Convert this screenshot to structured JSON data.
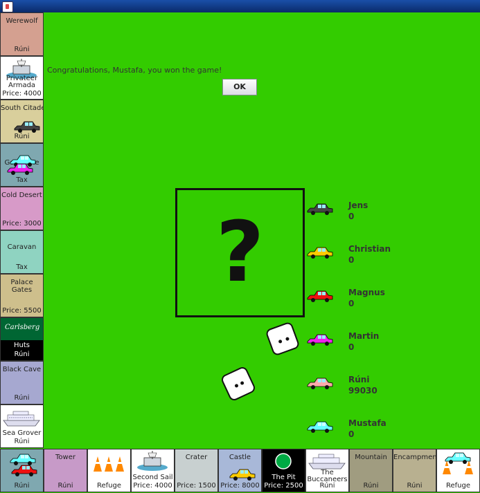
{
  "window": {
    "icon": "java-icon"
  },
  "message": "Congratulations, Mustafa, you won the game!",
  "ok_label": "OK",
  "center": {
    "symbol": "?"
  },
  "players": [
    {
      "name": "Jens",
      "score": "0",
      "color": "#444444"
    },
    {
      "name": "Christian",
      "score": "0",
      "color": "#ffcc00"
    },
    {
      "name": "Magnus",
      "score": "0",
      "color": "#ee1111"
    },
    {
      "name": "Martin",
      "score": "0",
      "color": "#ee22ee"
    },
    {
      "name": "Rúni",
      "score": "99030",
      "color": "#ffaaaa"
    },
    {
      "name": "Mustafa",
      "score": "0",
      "color": "#66ffff"
    }
  ],
  "left_tiles": [
    {
      "name": "Werewolf",
      "footer": "Rúni",
      "color": "#d4a090"
    },
    {
      "name": "Privateer Armada",
      "footer": "Price: 4000",
      "color": "#ffffff"
    },
    {
      "name": "South Citadel",
      "footer": "Rúni",
      "color": "#d9cf9c"
    },
    {
      "name": "Gold Mine",
      "footer": "Tax",
      "color": "#7fa8b0"
    },
    {
      "name": "Cold Desert",
      "footer": "Price: 3000",
      "color": "#d79ac8"
    },
    {
      "name": "Caravan",
      "footer": "Tax",
      "color": "#8fd3c1"
    },
    {
      "name": "Palace Gates",
      "footer": "Price: 5500",
      "color": "#cebf8c"
    },
    {
      "name": "Huts",
      "footer": "Rúni",
      "color": "#006633",
      "logo": "Carlsberg"
    },
    {
      "name": "Black Cave",
      "footer": "Rúni",
      "color": "#a6a8d0"
    },
    {
      "name": "Sea Grover",
      "footer": "Rúni",
      "color": "#ffffff"
    }
  ],
  "bottom_tiles": [
    {
      "name": "",
      "footer": "Rúni",
      "color": "#7fa8b0"
    },
    {
      "name": "Tower",
      "footer": "Rúni",
      "color": "#c79ac8"
    },
    {
      "name": "",
      "footer": "Refuge",
      "color": "#ffffff"
    },
    {
      "name": "Second Sail",
      "footer": "Price: 4000",
      "color": "#ffffff"
    },
    {
      "name": "Crater",
      "footer": "Price: 1500",
      "color": "#c8d0d0"
    },
    {
      "name": "Castle",
      "footer": "Price: 8000",
      "color": "#a8b8d8"
    },
    {
      "name": "The Pit",
      "footer": "Price: 2500",
      "color": "#000000",
      "logo": "TUBORG"
    },
    {
      "name": "The Buccaneers",
      "footer": "Rúni",
      "color": "#ffffff"
    },
    {
      "name": "Mountain",
      "footer": "Rúni",
      "color": "#a09c80"
    },
    {
      "name": "Encampment",
      "footer": "Rúni",
      "color": "#b8b090"
    },
    {
      "name": "",
      "footer": "Refuge",
      "color": "#ffffff"
    }
  ]
}
